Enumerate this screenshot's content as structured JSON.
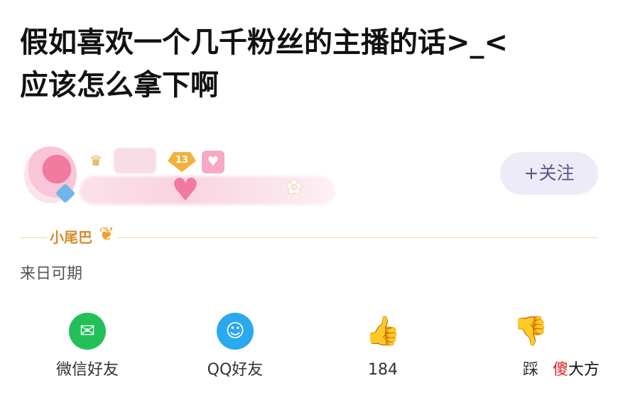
{
  "post": {
    "title": "假如喜欢一个几千粉丝的主播的话>_<\n应该怎么拿下啊"
  },
  "author": {
    "level": "13",
    "follow_label": "+关注"
  },
  "tail": {
    "label": "小尾巴",
    "text": "来日可期"
  },
  "actions": {
    "wechat_label": "微信好友",
    "qq_label": "QQ好友",
    "like_count": "184",
    "dislike_label": "踩"
  },
  "watermark": {
    "part1": "傻",
    "part2": "大方"
  },
  "icons": {
    "crown": "crown-icon",
    "medal": "medal-icon",
    "wechat": "wechat-icon",
    "qq": "qq-icon",
    "like": "thumbs-up-icon",
    "dislike": "thumbs-down-icon"
  },
  "colors": {
    "follow_bg": "#eeebf8",
    "tail_accent": "#d98a2b",
    "wechat_green": "#23c05a",
    "qq_blue": "#2aa8f0"
  }
}
